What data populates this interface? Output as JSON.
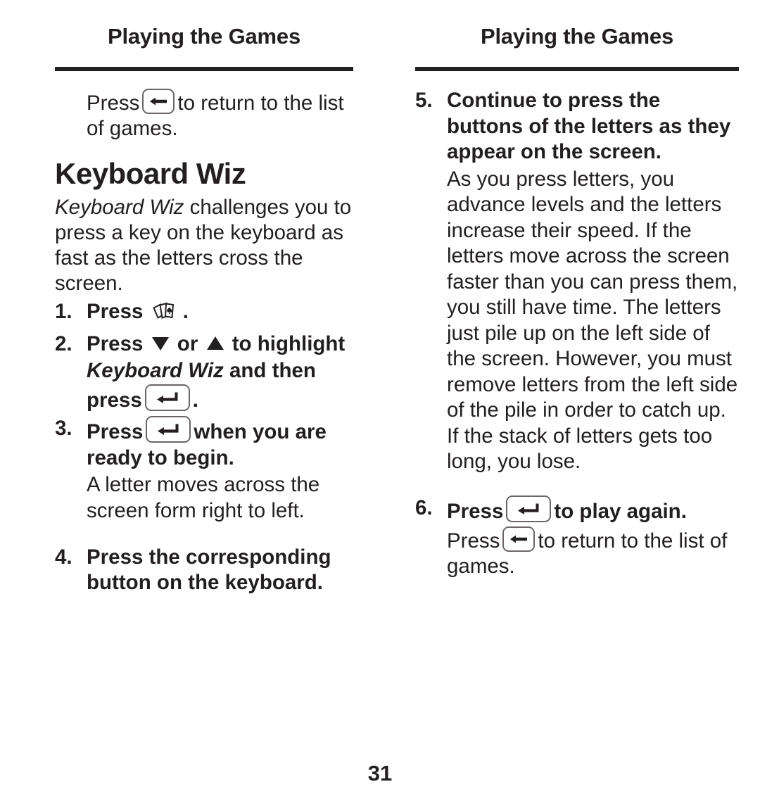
{
  "document": {
    "page_number": "31",
    "ink_color": "#231f20",
    "key_border_color": "#6b6569"
  },
  "left_column": {
    "running_header": "Playing the Games",
    "intro_paragraph": {
      "before_key": "Press",
      "key_icon": "back-arrow-key",
      "after_key": "to return to the list of games."
    },
    "section_title": "Keyboard Wiz",
    "section_intro": {
      "italic_lead": "Keyboard Wiz",
      "rest": " challenges you to press a key on the keyboard as fast as the letters cross the screen."
    },
    "steps": [
      {
        "number": "1.",
        "text_before": "Press",
        "icon": "playing-cards-icon",
        "text_after": "."
      },
      {
        "number": "2.",
        "text_before": "Press",
        "icon_down": "down-triangle-icon",
        "text_middle": "or",
        "icon_up": "up-triangle-icon",
        "text_after": "to highlight",
        "line2_italic": "Keyboard Wiz",
        "line2_rest": " and then press",
        "icon_enter": "enter-key",
        "line2_end": "."
      },
      {
        "number": "3.",
        "text_before": "Press",
        "icon": "enter-key",
        "text_after": "when you are ready to begin.",
        "sub_paragraph": "A letter moves across the screen form right to left."
      },
      {
        "number": "4.",
        "text": "Press the corresponding button on the keyboard."
      }
    ]
  },
  "right_column": {
    "running_header": "Playing the Games",
    "steps": [
      {
        "number": "5.",
        "text": "Continue to press the buttons of the letters as they appear on the screen.",
        "sub_paragraph": "As you press letters, you advance levels and the letters increase their speed. If the letters move across the screen faster than you can press them, you still have time. The letters just pile up on the left side of the screen. However, you must remove letters from the left side of the pile in order to catch up. If the stack of letters gets too long, you lose."
      },
      {
        "number": "6.",
        "text_before": "Press",
        "icon": "enter-key",
        "text_after": "to play again."
      }
    ],
    "closing_paragraph": {
      "before_key": "Press",
      "key_icon": "back-arrow-key",
      "after_key": "to return to the list of games."
    }
  }
}
